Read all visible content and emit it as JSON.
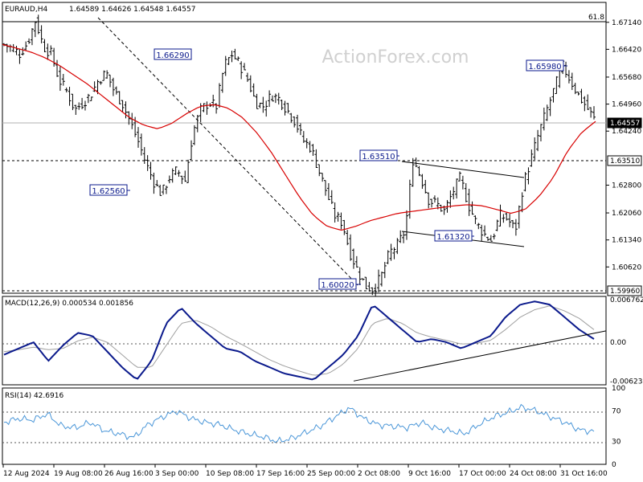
{
  "header": {
    "symbol": "EURAUD,H4",
    "ohlc": "1.64589 1.64626 1.64548 1.64557"
  },
  "watermark": "ActionForex.com",
  "colors": {
    "price": "#000000",
    "ma": "#d80000",
    "macd": "#0b1a8c",
    "signal": "#a0a0a0",
    "rsi": "#4a96d8",
    "callout_border": "#0b1a8c",
    "callout_text": "#0b1a8c"
  },
  "chart_data": [
    {
      "type": "candlestick",
      "title": "EURAUD,H4",
      "x_labels": [
        "12 Aug 2024",
        "19 Aug 08:00",
        "26 Aug 16:00",
        "3 Sep 00:00",
        "10 Sep 08:00",
        "17 Sep 16:00",
        "25 Sep 00:00",
        "2 Oct 08:00",
        "9 Oct 16:00",
        "17 Oct 00:00",
        "24 Oct 08:00",
        "31 Oct 16:00"
      ],
      "y_ticks": [
        "1.67140",
        "1.66420",
        "1.65680",
        "1.64960",
        "1.64240",
        "1.62800",
        "1.62060",
        "1.61340",
        "1.60620"
      ],
      "ylim": [
        1.5992,
        1.6767
      ],
      "current_price": "1.64557",
      "fib_level": {
        "label": "61.8",
        "value": 1.672
      },
      "horizontal_levels": [
        {
          "label": "1.63510",
          "value": 1.6351
        },
        {
          "label": "1.59960",
          "value": 1.5996
        }
      ],
      "price_path": [
        1.6655,
        1.6645,
        1.663,
        1.666,
        1.672,
        1.665,
        1.663,
        1.656,
        1.653,
        1.648,
        1.65,
        1.652,
        1.656,
        1.658,
        1.653,
        1.65,
        1.645,
        1.64,
        1.634,
        1.629,
        1.6256,
        1.63,
        1.632,
        1.629,
        1.642,
        1.648,
        1.65,
        1.649,
        1.66,
        1.6629,
        1.66,
        1.656,
        1.65,
        1.649,
        1.652,
        1.651,
        1.648,
        1.645,
        1.64,
        1.638,
        1.632,
        1.626,
        1.62,
        1.618,
        1.61,
        1.605,
        1.601,
        1.6002,
        1.604,
        1.61,
        1.612,
        1.616,
        1.6351,
        1.63,
        1.624,
        1.623,
        1.621,
        1.626,
        1.63,
        1.623,
        1.618,
        1.615,
        1.6132,
        1.62,
        1.619,
        1.616,
        1.628,
        1.635,
        1.642,
        1.648,
        1.654,
        1.6598,
        1.656,
        1.652,
        1.649,
        1.6456
      ],
      "ma_path": [
        1.6655,
        1.6645,
        1.6635,
        1.662,
        1.66,
        1.6575,
        1.655,
        1.652,
        1.649,
        1.646,
        1.644,
        1.643,
        1.6445,
        1.647,
        1.649,
        1.6495,
        1.6485,
        1.646,
        1.642,
        1.637,
        1.631,
        1.625,
        1.62,
        1.617,
        1.616,
        1.617,
        1.6185,
        1.6195,
        1.6205,
        1.621,
        1.6215,
        1.622,
        1.6225,
        1.6228,
        1.6225,
        1.6215,
        1.6205,
        1.6215,
        1.625,
        1.63,
        1.637,
        1.642,
        1.645
      ],
      "callouts": [
        "1.66290",
        "1.62560",
        "1.60020",
        "1.63510",
        "1.61320",
        "1.65980"
      ]
    },
    {
      "type": "line",
      "title": "MACD(12,26,9) 0.000534 0.001856",
      "y_ticks": [
        "0.006762",
        "0.00",
        "-0.006238"
      ],
      "ylim": [
        -0.0068,
        0.0073
      ],
      "macd": [
        -0.002,
        -0.001,
        0.0,
        -0.003,
        -0.0005,
        0.0015,
        0.001,
        -0.0015,
        -0.004,
        -0.006,
        -0.003,
        0.003,
        0.0055,
        0.003,
        0.001,
        -0.001,
        -0.0015,
        -0.003,
        -0.004,
        -0.005,
        -0.0055,
        -0.006,
        -0.004,
        -0.002,
        0.001,
        0.006,
        0.004,
        0.002,
        0.0,
        0.0005,
        0.0,
        -0.001,
        0.0,
        0.001,
        0.004,
        0.006,
        0.0065,
        0.006,
        0.004,
        0.002,
        0.0005
      ],
      "signal": [
        -0.0015,
        -0.0012,
        -0.0008,
        -0.0012,
        -0.001,
        0.0002,
        0.0008,
        0.0,
        -0.002,
        -0.004,
        -0.004,
        -0.0005,
        0.003,
        0.0035,
        0.0025,
        0.001,
        -0.0002,
        -0.0015,
        -0.0028,
        -0.0038,
        -0.0046,
        -0.0053,
        -0.005,
        -0.0035,
        -0.001,
        0.003,
        0.0038,
        0.003,
        0.0015,
        0.0008,
        0.0003,
        -0.0003,
        -0.0002,
        0.0003,
        0.002,
        0.004,
        0.0052,
        0.0058,
        0.005,
        0.0038,
        0.002
      ],
      "trendline": [
        -0.0062,
        0.0018
      ]
    },
    {
      "type": "line",
      "title": "RSI(14) 42.6916",
      "y_ticks": [
        "100",
        "70",
        "30",
        "0"
      ],
      "ylim": [
        0,
        100
      ],
      "rsi": [
        55,
        60,
        58,
        66,
        50,
        48,
        55,
        44,
        40,
        35,
        52,
        62,
        70,
        60,
        55,
        52,
        45,
        40,
        36,
        30,
        34,
        42,
        50,
        62,
        74,
        60,
        52,
        50,
        48,
        55,
        47,
        44,
        40,
        52,
        62,
        68,
        75,
        70,
        62,
        55,
        45,
        43
      ]
    }
  ]
}
